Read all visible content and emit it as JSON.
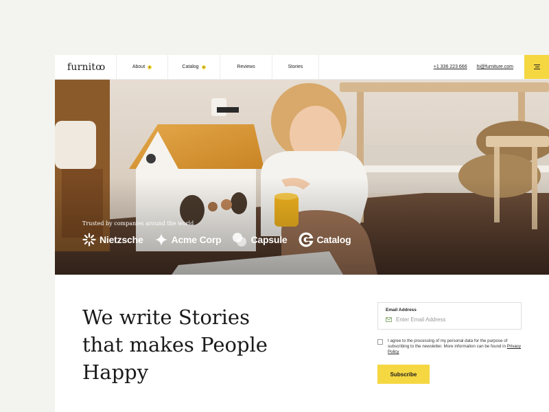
{
  "brand": {
    "logo": "furnitꝏ"
  },
  "nav": {
    "items": [
      {
        "label": "About",
        "has_dropdown": true
      },
      {
        "label": "Catalog",
        "has_dropdown": true
      },
      {
        "label": "Reviews",
        "has_dropdown": false
      },
      {
        "label": "Stories",
        "has_dropdown": false
      }
    ],
    "phone": "+1 336 223 666",
    "email": "hi@furniture.com",
    "menu_icon": "hamburger-menu-icon"
  },
  "hero": {
    "trusted_text": "Trusted by companies around the world",
    "brands": [
      {
        "name": "Nietzsche",
        "icon": "sunburst-icon"
      },
      {
        "name": "Acme Corp",
        "icon": "sparkle-icon"
      },
      {
        "name": "Capsule",
        "icon": "overlapping-circles-icon"
      },
      {
        "name": "Catalog",
        "icon": "c-letter-icon"
      }
    ]
  },
  "main": {
    "headline_lines": [
      "We write Stories",
      "that makes People",
      "Happy"
    ]
  },
  "newsletter": {
    "email_label": "Email Address",
    "email_placeholder": "Enter Email Address",
    "consent_text": "I agree to the processing of my personal data for the purpose of subscribing to the newsletter. More information can be found in",
    "policy_link": "Privacy Policy",
    "subscribe_label": "Subscribe"
  },
  "colors": {
    "accent": "#f5d742",
    "background": "#f3f4ef",
    "text": "#1a1a1a"
  }
}
